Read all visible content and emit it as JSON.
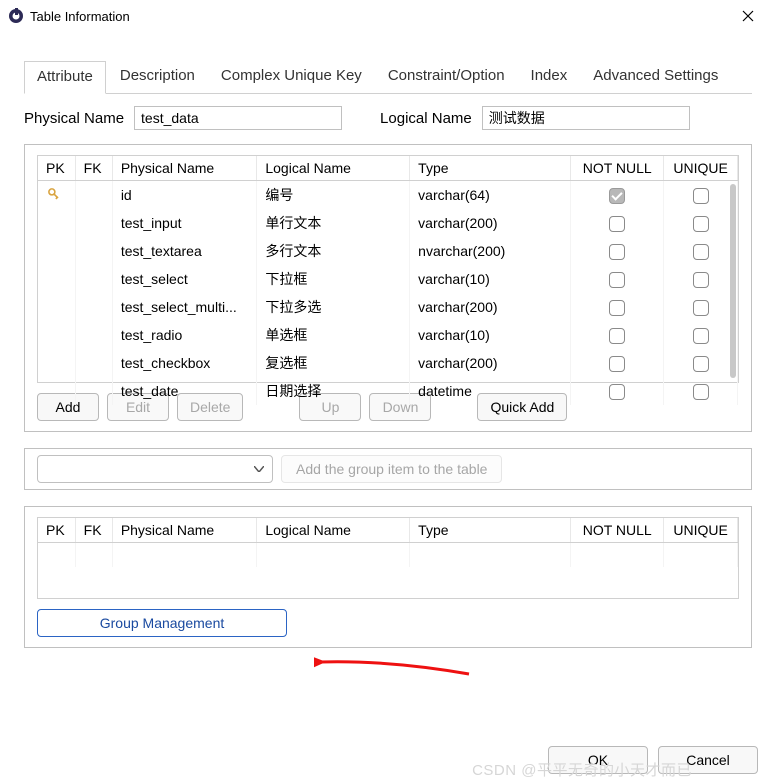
{
  "window": {
    "title": "Table Information"
  },
  "tabs": [
    "Attribute",
    "Description",
    "Complex Unique Key",
    "Constraint/Option",
    "Index",
    "Advanced Settings"
  ],
  "activeTab": 0,
  "nameLabels": {
    "physical": "Physical Name",
    "logical": "Logical Name"
  },
  "physicalName": "test_data",
  "logicalName": "测试数据",
  "columns": {
    "pk": "PK",
    "fk": "FK",
    "phys": "Physical Name",
    "log": "Logical Name",
    "type": "Type",
    "nn": "NOT NULL",
    "uq": "UNIQUE"
  },
  "rows": [
    {
      "pk": true,
      "fk": "",
      "phys": "id",
      "log": "编号",
      "type": "varchar(64)",
      "nn": true,
      "uq": false
    },
    {
      "pk": false,
      "fk": "",
      "phys": "test_input",
      "log": "单行文本",
      "type": "varchar(200)",
      "nn": false,
      "uq": false
    },
    {
      "pk": false,
      "fk": "",
      "phys": "test_textarea",
      "log": "多行文本",
      "type": "nvarchar(200)",
      "nn": false,
      "uq": false
    },
    {
      "pk": false,
      "fk": "",
      "phys": "test_select",
      "log": "下拉框",
      "type": "varchar(10)",
      "nn": false,
      "uq": false
    },
    {
      "pk": false,
      "fk": "",
      "phys": "test_select_multi...",
      "log": "下拉多选",
      "type": "varchar(200)",
      "nn": false,
      "uq": false
    },
    {
      "pk": false,
      "fk": "",
      "phys": "test_radio",
      "log": "单选框",
      "type": "varchar(10)",
      "nn": false,
      "uq": false
    },
    {
      "pk": false,
      "fk": "",
      "phys": "test_checkbox",
      "log": "复选框",
      "type": "varchar(200)",
      "nn": false,
      "uq": false
    },
    {
      "pk": false,
      "fk": "",
      "phys": "test_date",
      "log": "日期选择",
      "type": "datetime",
      "nn": false,
      "uq": false
    }
  ],
  "buttons": {
    "add": "Add",
    "edit": "Edit",
    "delete": "Delete",
    "up": "Up",
    "down": "Down",
    "quick": "Quick Add"
  },
  "groupSelect": "",
  "groupAddLabel": "Add the group item to the table",
  "groupMgmt": "Group Management",
  "footer": {
    "ok": "OK",
    "cancel": "Cancel"
  },
  "watermark": "CSDN @平平无奇的小天才而已"
}
